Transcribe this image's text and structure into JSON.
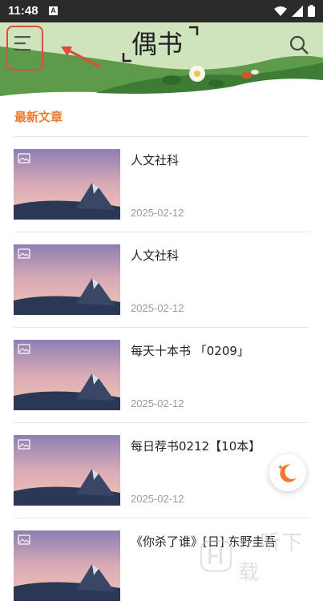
{
  "status_bar": {
    "time": "11:48",
    "sim_label": "A"
  },
  "header": {
    "logo_text": "偶书",
    "icons": [
      "menu-icon",
      "search-icon"
    ]
  },
  "section": {
    "title": "最新文章"
  },
  "articles": [
    {
      "title": "人文社科",
      "date": "2025-02-12"
    },
    {
      "title": "人文社科",
      "date": "2025-02-12"
    },
    {
      "title": "每天十本书 「0209」",
      "date": "2025-02-12"
    },
    {
      "title": "每日荐书0212【10本】",
      "date": "2025-02-12"
    },
    {
      "title": "《你杀了谁》[日] 东野圭吾",
      "date": ""
    }
  ],
  "watermark": {
    "text": "一听下载"
  },
  "colors": {
    "accent": "#ee7a2c",
    "annotation": "#e24a3b",
    "header_green": "#b9d6a3"
  }
}
